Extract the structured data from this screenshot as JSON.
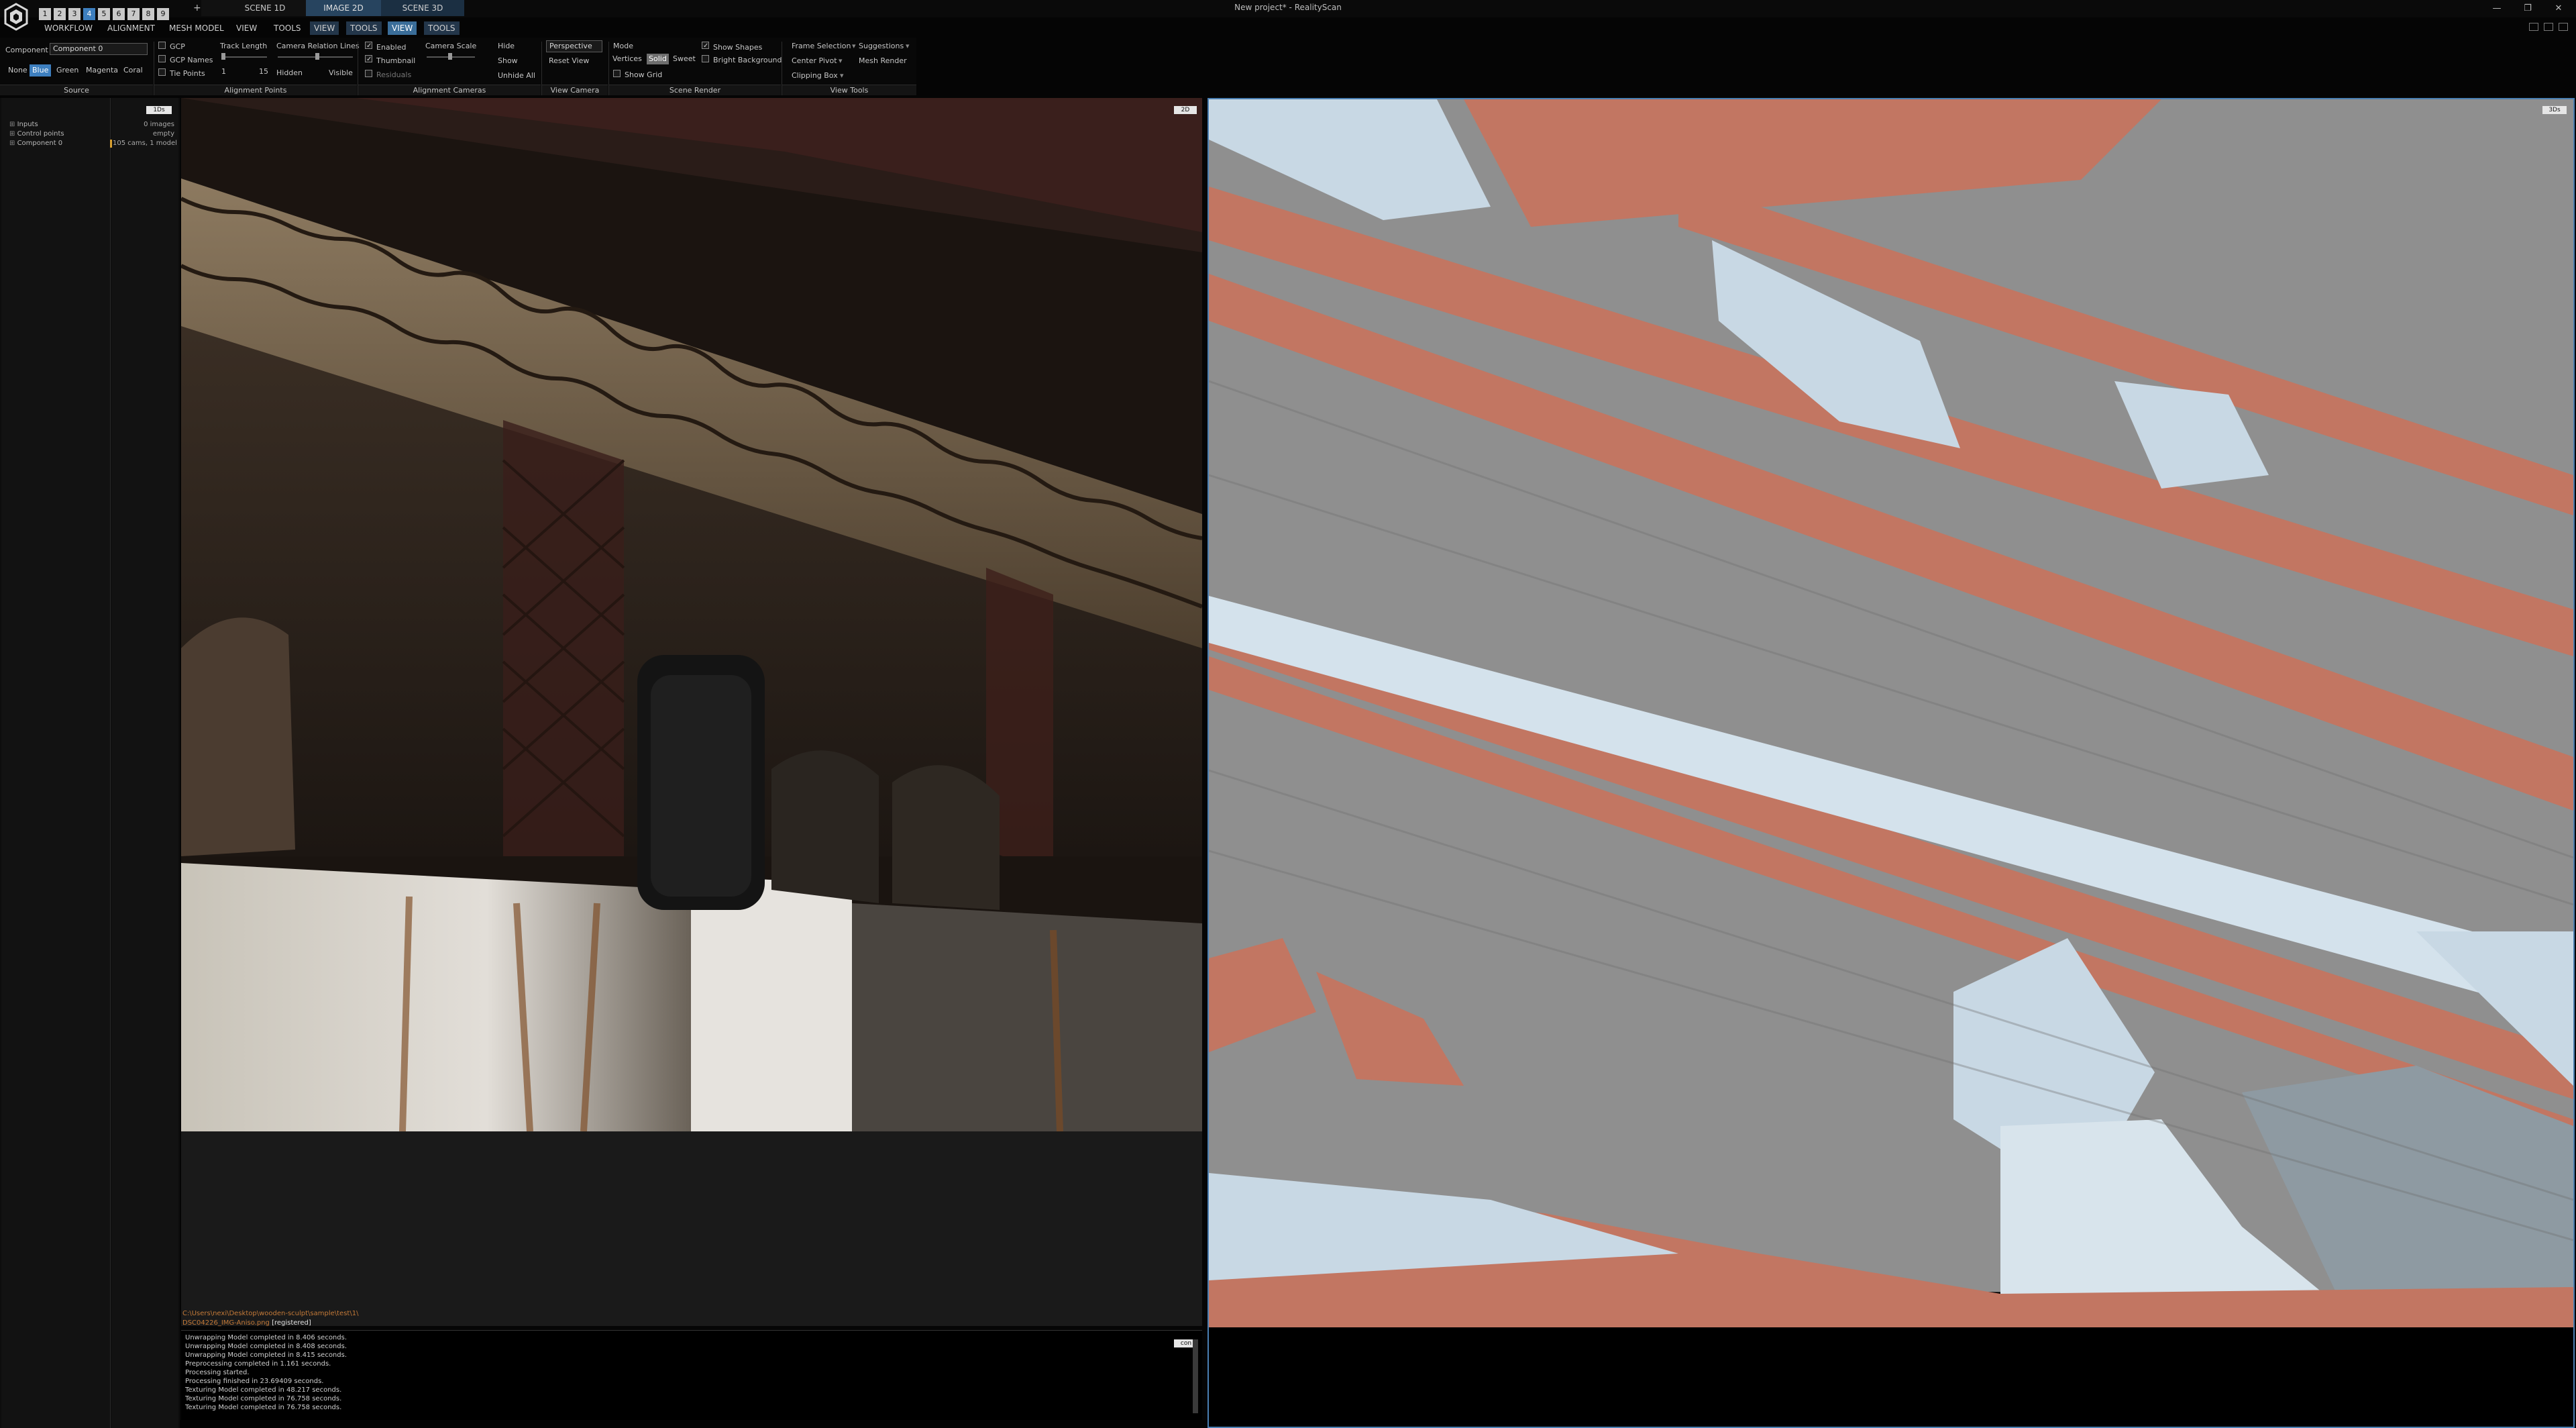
{
  "app": {
    "window_title": "New project* - RealityScan",
    "tabs": [
      {
        "label": "SCENE 1D"
      },
      {
        "label": "IMAGE 2D"
      },
      {
        "label": "SCENE 3D"
      }
    ],
    "quick_layouts": [
      "1",
      "2",
      "3",
      "4",
      "5",
      "6",
      "7",
      "8",
      "9"
    ],
    "add_tab": "+"
  },
  "menu": {
    "items": [
      "WORKFLOW",
      "ALIGNMENT",
      "MESH MODEL",
      "VIEW",
      "TOOLS"
    ],
    "context_2d": [
      "VIEW",
      "TOOLS"
    ],
    "context_3d": [
      "VIEW",
      "TOOLS"
    ]
  },
  "ribbon": {
    "source": {
      "component_label": "Component",
      "component_value": "Component 0",
      "colors": [
        "None",
        "Blue",
        "Green",
        "Magenta",
        "Coral"
      ],
      "selected_color": "Blue",
      "group_label": "Source"
    },
    "alignment_points": {
      "gcp": "GCP",
      "gcp_names": "GCP Names",
      "tie_points": "Tie Points",
      "track_length": "Track Length",
      "track_min": "1",
      "track_max": "15",
      "camera_relation_lines": "Camera Relation Lines",
      "hidden": "Hidden",
      "visible": "Visible",
      "group_label": "Alignment Points"
    },
    "alignment_cameras": {
      "enabled": "Enabled",
      "thumbnail": "Thumbnail",
      "residuals": "Residuals",
      "camera_scale": "Camera Scale",
      "group_label": "Alignment Cameras"
    },
    "view_camera": {
      "hide": "Hide",
      "show": "Show",
      "unhide_all": "Unhide All",
      "projection": "Perspective",
      "reset_view": "Reset View",
      "group_label": "View Camera"
    },
    "scene_render": {
      "mode": "Mode",
      "vertices": "Vertices",
      "solid": "Solid",
      "sweet": "Sweet",
      "selected_mode": "Solid",
      "show_grid": "Show Grid",
      "show_shapes": "Show Shapes",
      "bright_background": "Bright Background",
      "group_label": "Scene Render"
    },
    "view_tools": {
      "frame_selection": "Frame Selection",
      "center_pivot": "Center Pivot",
      "clipping_box": "Clipping Box",
      "suggestions": "Suggestions",
      "mesh_render": "Mesh Render",
      "group_label": "View Tools"
    }
  },
  "left_panel": {
    "tree": [
      {
        "label": "Inputs",
        "info": "0 images"
      },
      {
        "label": "Control points",
        "info": "empty"
      },
      {
        "label": "Component 0",
        "info": "105 cams, 1 model"
      }
    ],
    "badge": "1Ds"
  },
  "view2d": {
    "badge": "2D",
    "console_path": "C:\\Users\\nexi\\Desktop\\wooden-sculpt\\sample\\test\\1\\",
    "console_file": "DSC04226_IMG-Aniso.png",
    "console_file_status": "[registered]",
    "console_badge": "con",
    "log": [
      "Unwrapping Model completed in 8.406 seconds.",
      "Unwrapping Model completed in 8.408 seconds.",
      "Unwrapping Model completed in 8.415 seconds.",
      "Preprocessing completed in 1.161 seconds.",
      "Processing started.",
      "Processing finished in 23.69409 seconds.",
      "Texturing Model completed in 48.217 seconds.",
      "Texturing Model completed in 76.758 seconds.",
      "Texturing Model completed in 76.758 seconds."
    ]
  },
  "view3d": {
    "badge": "3Ds"
  },
  "colors": {
    "accent": "#3d7fbf",
    "tab_active": "#27445f",
    "mesh_gray": "#8f8f8f",
    "mesh_coral": "#c27662",
    "mesh_light": "#c8d8e4",
    "log_path": "#c47a38"
  },
  "icons": {
    "logo": "realityscan-logo-icon",
    "minimize": "minimize-icon",
    "restore": "restore-icon",
    "close": "close-icon"
  }
}
